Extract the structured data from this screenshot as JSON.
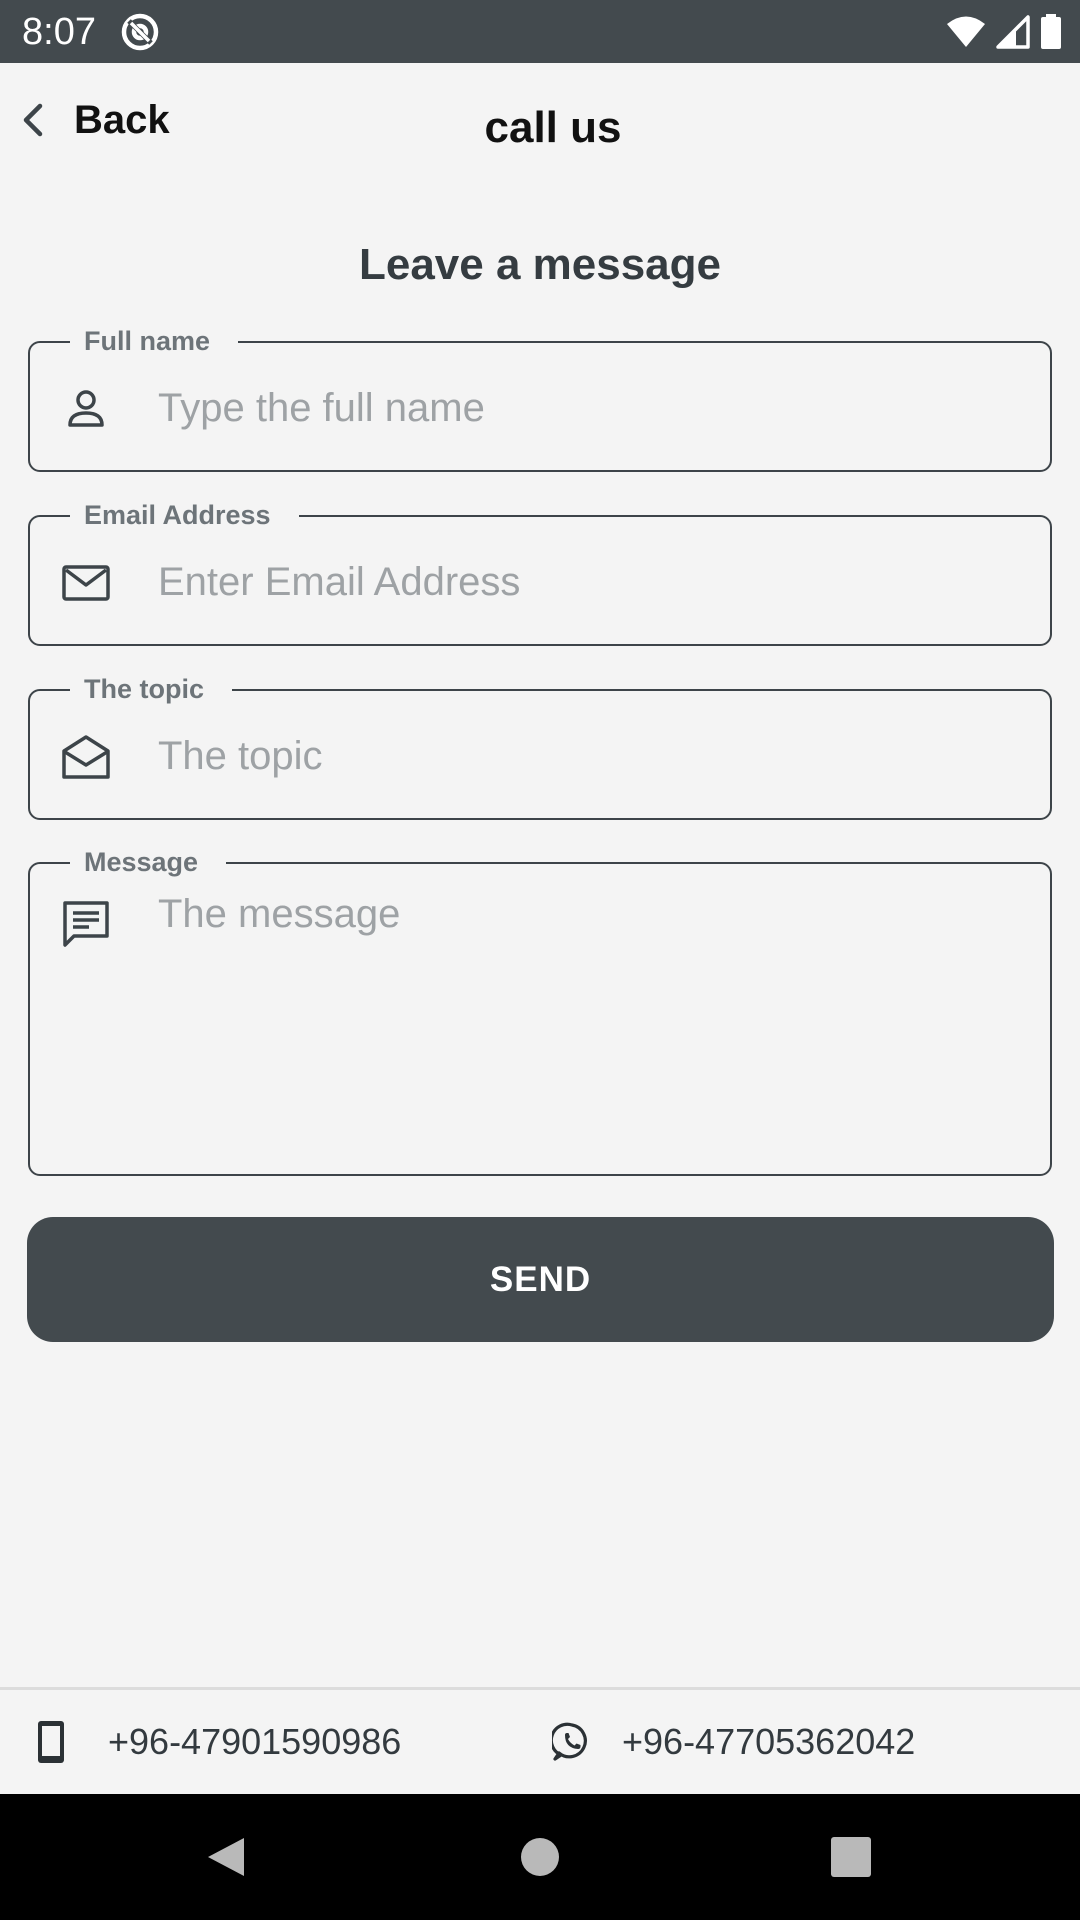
{
  "status_bar": {
    "time": "8:07"
  },
  "header": {
    "back_label": "Back",
    "title": "call us"
  },
  "form": {
    "section_title": "Leave a message",
    "full_name": {
      "label": "Full name",
      "placeholder": "Type the full name",
      "value": "",
      "icon": "person-icon"
    },
    "email": {
      "label": "Email Address",
      "placeholder": "Enter Email Address",
      "value": "",
      "icon": "mail-icon"
    },
    "topic": {
      "label": "The topic",
      "placeholder": "The topic",
      "value": "",
      "icon": "open-envelope-icon"
    },
    "message": {
      "label": "Message",
      "placeholder": "The message",
      "value": "",
      "icon": "message-icon"
    },
    "send_label": "SEND"
  },
  "contacts": {
    "phone": {
      "icon": "phone-icon",
      "number": "+96-47901590986"
    },
    "whatsapp": {
      "icon": "whatsapp-icon",
      "number": "+96-47705362042"
    }
  },
  "colors": {
    "status_bar": "#434a4e",
    "background": "#f4f4f4",
    "button": "#434a4e",
    "border": "#3d4449",
    "nav_bar": "#000000"
  }
}
